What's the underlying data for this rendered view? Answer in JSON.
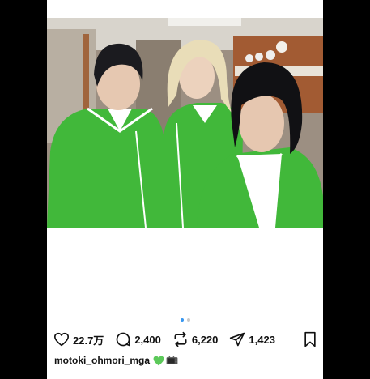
{
  "post": {
    "likes": "22.7万",
    "comments": "2,400",
    "reposts": "6,220",
    "shares": "1,423",
    "username": "motoki_ohmori_mga",
    "emojis": [
      "green-heart",
      "television"
    ],
    "carousel": {
      "total": 2,
      "active": 1
    }
  },
  "colors": {
    "jersey_green": "#41b83a",
    "accent_blue": "#3897f0",
    "heart_green": "#5cc95a"
  },
  "icons": [
    "heart-icon",
    "comment-icon",
    "repost-icon",
    "share-icon",
    "bookmark-icon"
  ]
}
